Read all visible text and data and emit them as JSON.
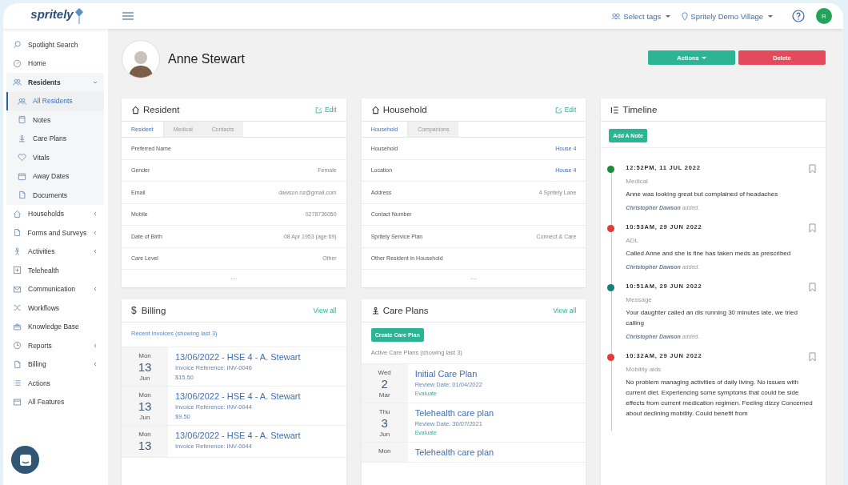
{
  "header": {
    "logo": "spritely",
    "tags": "Select tags",
    "location": "Spritely Demo Village",
    "user_initial": "R"
  },
  "sidebar": {
    "items": [
      {
        "label": "Spotlight Search",
        "expandable": false,
        "expanded": false,
        "selected": false
      },
      {
        "label": "Home",
        "expandable": false,
        "expanded": false,
        "selected": false
      },
      {
        "label": "Residents",
        "expandable": true,
        "expanded": true,
        "selected": false,
        "children": [
          {
            "label": "All Residents",
            "selected": true
          },
          {
            "label": "Notes",
            "selected": false
          },
          {
            "label": "Care Plans",
            "selected": false
          },
          {
            "label": "Vitals",
            "selected": false
          },
          {
            "label": "Away Dates",
            "selected": false
          },
          {
            "label": "Documents",
            "selected": false
          }
        ]
      },
      {
        "label": "Households",
        "expandable": true,
        "expanded": false,
        "selected": false
      },
      {
        "label": "Forms and Surveys",
        "expandable": true,
        "expanded": false,
        "selected": false
      },
      {
        "label": "Activities",
        "expandable": true,
        "expanded": false,
        "selected": false
      },
      {
        "label": "Telehealth",
        "expandable": false,
        "expanded": false,
        "selected": false
      },
      {
        "label": "Communication",
        "expandable": true,
        "expanded": false,
        "selected": false
      },
      {
        "label": "Workflows",
        "expandable": false,
        "expanded": false,
        "selected": false
      },
      {
        "label": "Knowledge Base",
        "expandable": false,
        "expanded": false,
        "selected": false
      },
      {
        "label": "Reports",
        "expandable": true,
        "expanded": false,
        "selected": false
      },
      {
        "label": "Billing",
        "expandable": true,
        "expanded": false,
        "selected": false
      },
      {
        "label": "Actions",
        "expandable": false,
        "expanded": false,
        "selected": false
      },
      {
        "label": "All Features",
        "expandable": false,
        "expanded": false,
        "selected": false
      }
    ]
  },
  "profile": {
    "name": "Anne Stewart",
    "actions": "Actions",
    "delete": "Delete"
  },
  "resident": {
    "title": "Resident",
    "edit": "Edit",
    "tabs": [
      {
        "label": "Resident",
        "selected": true
      },
      {
        "label": "Medical",
        "selected": false
      },
      {
        "label": "Contacts",
        "selected": false
      }
    ],
    "fields": [
      {
        "label": "Preferred Name"
      },
      {
        "label": "Gender",
        "value": "Female",
        "link": false
      },
      {
        "label": "Email",
        "value": "dawson.nz@gmail.com",
        "link": false
      },
      {
        "label": "Mobile",
        "value": "0278736050",
        "link": false
      },
      {
        "label": "Date of Birth",
        "value": "08 Apr 1953 (age 69)",
        "link": false
      },
      {
        "label": "Care Level",
        "value": "Other",
        "link": false
      }
    ],
    "more": "···"
  },
  "household": {
    "title": "Household",
    "edit": "Edit",
    "tabs": [
      {
        "label": "Household",
        "selected": true
      },
      {
        "label": "Companions",
        "selected": false
      }
    ],
    "fields": [
      {
        "label": "Household",
        "value": "House 4",
        "link": true
      },
      {
        "label": "Location",
        "value": "House 4",
        "link": true
      },
      {
        "label": "Address",
        "value": "4 Spritely Lane",
        "link": false
      },
      {
        "label": "Contact Number"
      },
      {
        "label": "Spritely Service Plan",
        "value": "Connect & Care",
        "link": false
      },
      {
        "label": "Other Resident in Household"
      }
    ],
    "more": "···"
  },
  "billing": {
    "symbol": "$",
    "title": "Billing",
    "view_all": "View all",
    "subtitle": "Recent invoices (showing last 3)",
    "invoices": [
      {
        "weekday": "Mon",
        "day": "13",
        "month": "Jun",
        "title": "13/06/2022 - HSE 4 - A. Stewart",
        "reference": "Invoice Reference: INV-0046",
        "amount": "$15.50"
      },
      {
        "weekday": "Mon",
        "day": "13",
        "month": "Jun",
        "title": "13/06/2022 - HSE 4 - A. Stewart",
        "reference": "Invoice Reference: INV-0044",
        "amount": "$9.50"
      },
      {
        "weekday": "Mon",
        "day": "13",
        "title": "13/06/2022 - HSE 4 - A. Stewart",
        "reference": "Invoice Reference: INV-0044"
      }
    ]
  },
  "care_plans": {
    "title": "Care Plans",
    "view_all": "View all",
    "create": "Create Care Plan",
    "subtitle": "Active Care Plans (showing last 3)",
    "plans": [
      {
        "weekday": "Wed",
        "day": "2",
        "month": "Mar",
        "title": "Initial Care Plan",
        "review": "Review Date: 01/04/2022",
        "action": "Evaluate"
      },
      {
        "weekday": "Thu",
        "day": "3",
        "month": "Jun",
        "title": "Telehealth care plan",
        "review": "Review Date: 30/07/2021",
        "action": "Evaluate"
      },
      {
        "weekday": "Mon",
        "title": "Telehealth care plan"
      }
    ]
  },
  "timeline": {
    "title": "Timeline",
    "add_note": "Add A Note",
    "entries": [
      {
        "time": "12:52PM, 11 JUL 2022",
        "category": "Medical",
        "text": "Anne was looking great but complained of headaches",
        "author": "Christopher Dawson",
        "suffix": "added.",
        "color": "#1e8c3a"
      },
      {
        "time": "10:53AM, 29 JUN 2022",
        "category": "ADL",
        "text": "Called Anne and she is fine has taken meds as prescribed",
        "author": "Christopher Dawson",
        "suffix": "added.",
        "color": "#e53935"
      },
      {
        "time": "10:51AM, 29 JUN 2022",
        "category": "Message",
        "text": "Your daughter called an dis running 30 minutes late, we tried calling",
        "author": "Christopher Dawson",
        "suffix": "added.",
        "color": "#13807a"
      },
      {
        "time": "10:32AM, 29 JUN 2022",
        "category": "Mobility aids",
        "text": "No problem managing activities of daily living. No issues with current diet. Experiencing some symptoms that could be side effects from current medication regimen. Feeling dizzy Concerned about declining mobility. Could benefit from",
        "color": "#e53935"
      }
    ]
  }
}
